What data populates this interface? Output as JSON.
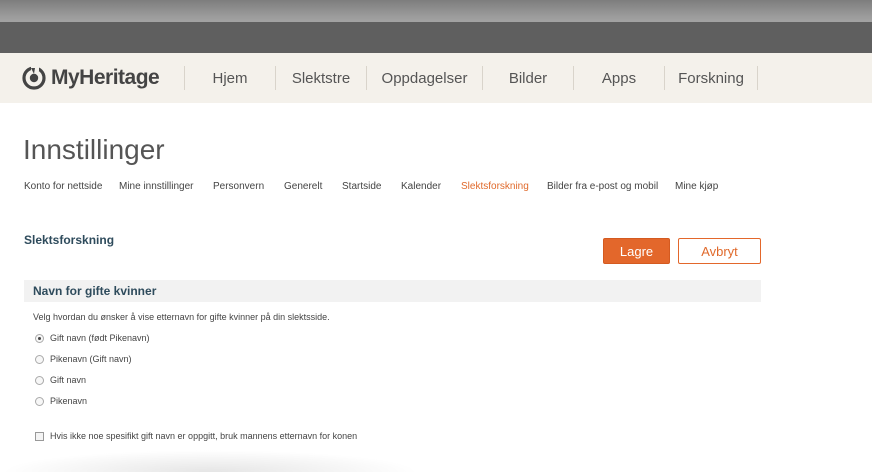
{
  "header": {
    "logo_text": "MyHeritage",
    "nav": [
      "Hjem",
      "Slektstre",
      "Oppdagelser",
      "Bilder",
      "Apps",
      "Forskning"
    ]
  },
  "page": {
    "title": "Innstillinger",
    "subnav": [
      "Konto for nettside",
      "Mine innstillinger",
      "Personvern",
      "Generelt",
      "Startside",
      "Kalender",
      "Slektsforskning",
      "Bilder fra e-post og mobil",
      "Mine kjøp"
    ],
    "active_subnav": "Slektsforskning"
  },
  "section": {
    "title": "Slektsforskning",
    "save_label": "Lagre",
    "cancel_label": "Avbryt"
  },
  "married_names": {
    "title": "Navn for gifte kvinner",
    "description": "Velg hvordan du ønsker å vise etternavn for gifte kvinner på din slektsside.",
    "options": [
      "Gift navn (født Pikenavn)",
      "Pikenavn (Gift navn)",
      "Gift navn",
      "Pikenavn"
    ],
    "selected": "Gift navn (født Pikenavn)",
    "checkbox_label": "Hvis ikke noe spesifikt gift navn er oppgitt, bruk mannens etternavn for konen",
    "checkbox_checked": false
  },
  "colors": {
    "accent": "#e3672b",
    "heading": "#2e4b5c",
    "header_bg": "#f4f1eb"
  }
}
